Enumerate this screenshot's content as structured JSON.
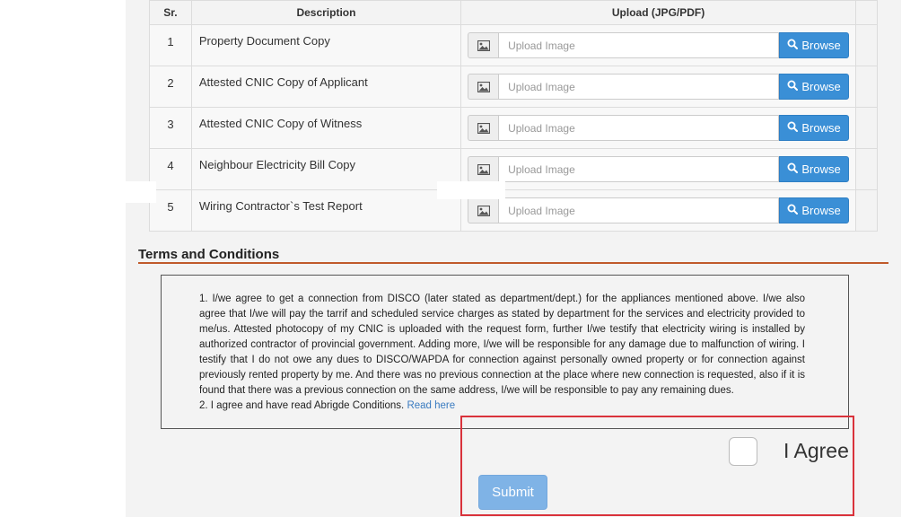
{
  "table": {
    "headers": {
      "sr": "Sr.",
      "description": "Description",
      "upload": "Upload (JPG/PDF)"
    },
    "rows": [
      {
        "sr": "1",
        "description": "Property Document Copy",
        "placeholder": "Upload Image",
        "browse": "Browse"
      },
      {
        "sr": "2",
        "description": "Attested CNIC Copy of Applicant",
        "placeholder": "Upload Image",
        "browse": "Browse"
      },
      {
        "sr": "3",
        "description": "Attested CNIC Copy of Witness",
        "placeholder": "Upload Image",
        "browse": "Browse"
      },
      {
        "sr": "4",
        "description": "Neighbour Electricity Bill Copy",
        "placeholder": "Upload Image",
        "browse": "Browse"
      },
      {
        "sr": "5",
        "description": "Wiring Contractor`s Test Report",
        "placeholder": "Upload Image",
        "browse": "Browse"
      }
    ]
  },
  "terms": {
    "title": "Terms and Conditions",
    "paragraph1": "1. I/we agree to get a connection from DISCO (later stated as department/dept.) for the appliances mentioned above. I/we also agree that I/we will pay the tarrif and scheduled service charges as stated by department for the services and electricity provided to me/us. Attested photocopy of my CNIC is uploaded with the request form, further I/we testify that electricity wiring is installed by authorized contractor of provincial government. Adding more, I/we will be responsible for any damage due to malfunction of wiring. I testify that I do not owe any dues to DISCO/WAPDA for connection against personally owned property or for connection against previously rented property by me. And there was no previous connection at the place where new connection is requested, also if it is found that there was a previous connection on the same address, I/we will be responsible to pay any remaining dues.",
    "paragraph2": "2. I agree and have read Abrigde Conditions.",
    "read_here": "Read here"
  },
  "agree": {
    "label": "I Agree",
    "checked": false
  },
  "submit_label": "Submit",
  "colors": {
    "primary": "#3a8fd6",
    "submit": "#7fb3e6",
    "highlight": "#d9323b",
    "rule": "#c05a2a"
  },
  "icons": {
    "image": "image-icon",
    "search": "search-icon"
  }
}
